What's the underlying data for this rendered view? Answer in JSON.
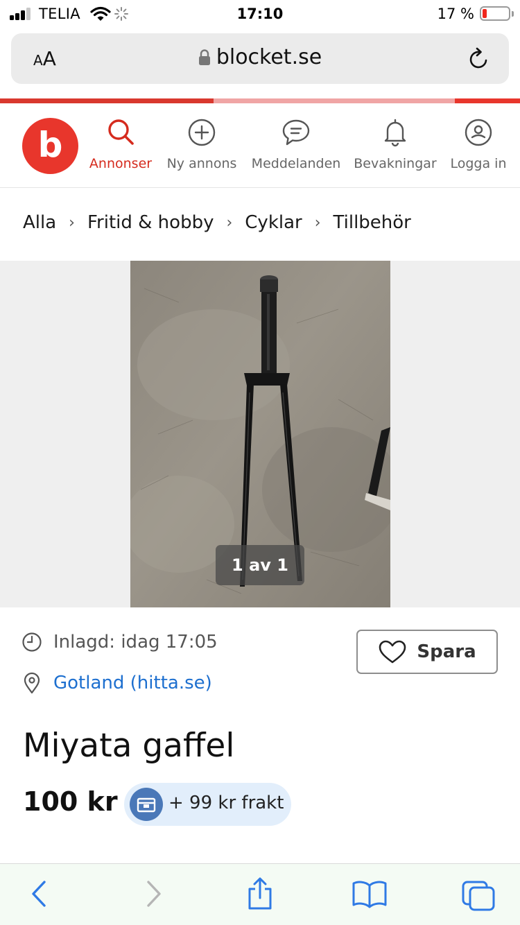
{
  "status_bar": {
    "carrier": "TELIA",
    "time": "17:10",
    "battery_percent": "17 %",
    "battery_level": 0.17
  },
  "browser": {
    "text_size_label_small": "A",
    "text_size_label_large": "A",
    "url": "blocket.se"
  },
  "page_load_progress": 0.41,
  "header": {
    "logo_letter": "b",
    "nav": [
      {
        "label": "Annonser",
        "icon": "search-icon",
        "active": true
      },
      {
        "label": "Ny annons",
        "icon": "plus-circle-icon",
        "active": false
      },
      {
        "label": "Meddelanden",
        "icon": "chat-bubble-icon",
        "active": false
      },
      {
        "label": "Bevakningar",
        "icon": "bell-icon",
        "active": false
      },
      {
        "label": "Logga in",
        "icon": "user-icon",
        "active": false
      }
    ]
  },
  "breadcrumb": [
    "Alla",
    "Fritid & hobby",
    "Cyklar",
    "Tillbehör"
  ],
  "gallery": {
    "counter": "1 av 1",
    "image_subject": "black bicycle fork on concrete floor"
  },
  "listing": {
    "posted": "Inlagd: idag 17:05",
    "location": "Gotland (hitta.se)",
    "save_label": "Spara",
    "title": "Miyata gaffel",
    "price": "100 kr",
    "shipping": "+ 99 kr frakt"
  },
  "colors": {
    "brand_red": "#e8362c",
    "active_nav": "#d52b1e",
    "link_blue": "#1d6fcf",
    "toolbar_blue": "#2f7ae5",
    "shipping_pill": "#e2eefb"
  }
}
